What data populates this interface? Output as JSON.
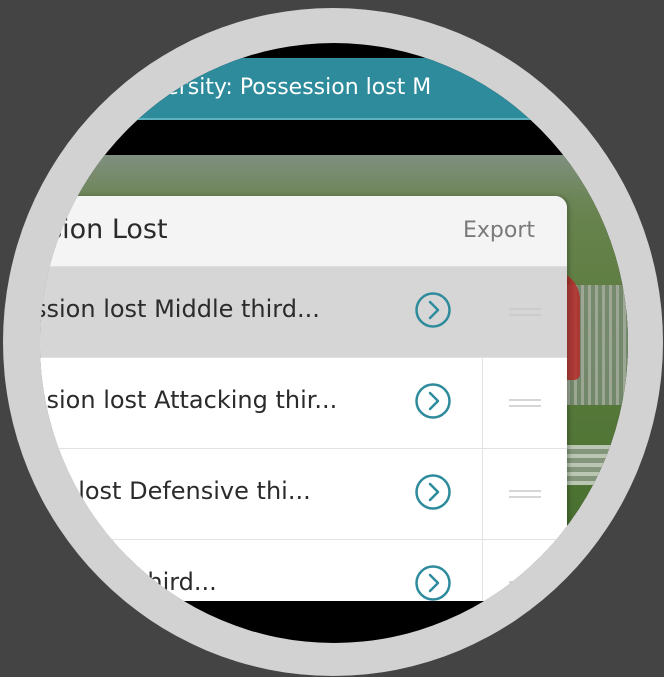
{
  "title_bar": {
    "text": "r University: Possession lost M"
  },
  "panel": {
    "title": "ssion Lost",
    "export_label": "Export",
    "rows": [
      {
        "label": "ssion lost Middle third...",
        "selected": true
      },
      {
        "label": "ssion lost Attacking thir...",
        "selected": false
      },
      {
        "label": "ion lost Defensive thi...",
        "selected": false
      },
      {
        "label": "t Middle third...",
        "selected": false
      }
    ]
  },
  "colors": {
    "accent": "#2d8b9c",
    "ring": "#d2d2d2",
    "background": "#444444",
    "selected_row": "#d6d6d6"
  },
  "icons": [
    "chevron-right-circle-icon",
    "drag-handle-icon"
  ]
}
